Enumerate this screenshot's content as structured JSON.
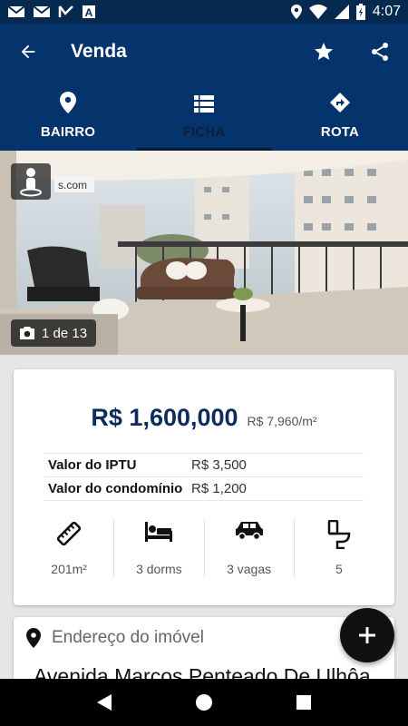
{
  "status_bar": {
    "time": "4:07",
    "left_icons": [
      "gmail-icon",
      "gmail-icon",
      "check-flag-icon",
      "app-a-icon"
    ],
    "right_icons": [
      "location-icon",
      "wifi-icon",
      "signal-icon",
      "battery-icon"
    ]
  },
  "app_bar": {
    "title": "Venda",
    "back_icon": "arrow-back-icon",
    "actions": [
      "star-icon",
      "share-icon"
    ]
  },
  "tabs": [
    {
      "label": "BAIRRO",
      "icon": "location-pin-icon",
      "active": false
    },
    {
      "label": "FICHA",
      "icon": "list-icon",
      "active": true
    },
    {
      "label": "ROTA",
      "icon": "directions-icon",
      "active": false
    }
  ],
  "photo": {
    "counter": "1 de 13",
    "watermark": "s.com"
  },
  "listing": {
    "price": "R$ 1,600,000",
    "price_per_m2": "R$ 7,960/m²",
    "fees": [
      {
        "label": "Valor do IPTU",
        "value": "R$ 3,500"
      },
      {
        "label": "Valor do condomínio",
        "value": "R$ 1,200"
      }
    ],
    "features": [
      {
        "label": "201m²",
        "icon": "ruler-icon"
      },
      {
        "label": "3 dorms",
        "icon": "bed-icon"
      },
      {
        "label": "3 vagas",
        "icon": "car-icon"
      },
      {
        "label": "5",
        "icon": "toilet-icon"
      }
    ]
  },
  "address": {
    "label": "Endereço do imóvel",
    "street": "Avenida Marcos Penteado De Ulhôa"
  },
  "fab": {
    "icon": "plus-icon"
  },
  "colors": {
    "status_bar": "#05294f",
    "app_bar": "#05336b",
    "price": "#0c2b5f"
  }
}
